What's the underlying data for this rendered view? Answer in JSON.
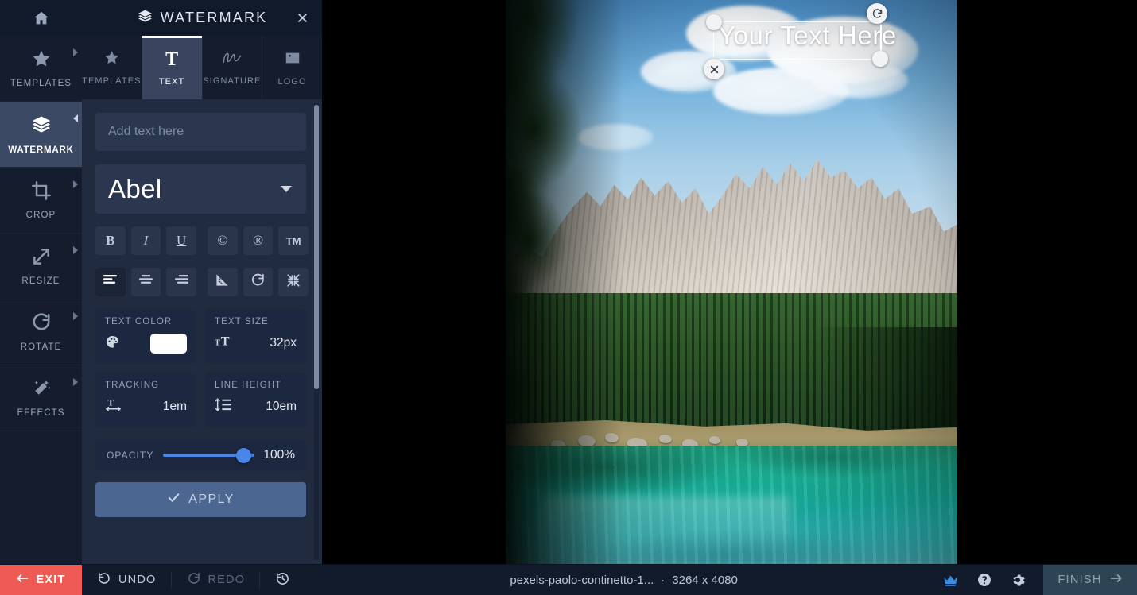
{
  "rail": {
    "home_icon": "home-icon",
    "items": [
      {
        "label": "TEMPLATES",
        "icon": "star-icon",
        "active": false,
        "arrow": "right"
      },
      {
        "label": "WATERMARK",
        "icon": "layers-icon",
        "active": true,
        "arrow": "left"
      },
      {
        "label": "CROP",
        "icon": "crop-icon",
        "active": false,
        "arrow": "right"
      },
      {
        "label": "RESIZE",
        "icon": "resize-icon",
        "active": false,
        "arrow": "right"
      },
      {
        "label": "ROTATE",
        "icon": "rotate-icon",
        "active": false,
        "arrow": "right"
      },
      {
        "label": "EFFECTS",
        "icon": "magicwand-icon",
        "active": false,
        "arrow": "right"
      }
    ]
  },
  "panel": {
    "title": "WATERMARK",
    "title_icon": "layers-icon",
    "close_icon": "close-icon",
    "tabs": [
      {
        "label": "TEMPLATES",
        "icon": "star-icon",
        "active": false
      },
      {
        "label": "TEXT",
        "icon": "text-t-icon",
        "active": true
      },
      {
        "label": "SIGNATURE",
        "icon": "signature-icon",
        "active": false
      },
      {
        "label": "LOGO",
        "icon": "image-icon",
        "active": false
      }
    ],
    "text_input": {
      "value": "",
      "placeholder": "Add text here"
    },
    "font": {
      "selected": "Abel",
      "caret_icon": "chevron-down-icon"
    },
    "style_buttons": [
      {
        "label": "B",
        "name": "bold-button",
        "active": false
      },
      {
        "label": "I",
        "name": "italic-button",
        "active": false
      },
      {
        "label": "U",
        "name": "underline-button",
        "active": false
      },
      {
        "label": "©",
        "name": "copyright-button",
        "active": false
      },
      {
        "label": "®",
        "name": "registered-button",
        "active": false
      },
      {
        "label": "TM",
        "name": "trademark-button",
        "active": false
      }
    ],
    "align_buttons": [
      {
        "name": "align-left-button",
        "icon": "align-left-icon",
        "active": true
      },
      {
        "name": "align-center-button",
        "icon": "align-center-icon",
        "active": false
      },
      {
        "name": "align-right-button",
        "icon": "align-right-icon",
        "active": false
      }
    ],
    "transform_buttons": [
      {
        "name": "skew-button",
        "icon": "triangle-ruler-icon",
        "active": false
      },
      {
        "name": "rotate-button",
        "icon": "rotate-cw-icon",
        "active": false
      },
      {
        "name": "shrink-button",
        "icon": "collapse-arrows-icon",
        "active": false
      }
    ],
    "fields": [
      {
        "label": "TEXT COLOR",
        "value": "",
        "icon": "palette-icon",
        "swatch": "#ffffff"
      },
      {
        "label": "TEXT SIZE",
        "value": "32px",
        "icon": "font-size-icon",
        "swatch": null
      },
      {
        "label": "TRACKING",
        "value": "1em",
        "icon": "tracking-icon",
        "swatch": null
      },
      {
        "label": "LINE HEIGHT",
        "value": "10em",
        "icon": "line-height-icon",
        "swatch": null
      }
    ],
    "opacity": {
      "label": "OPACITY",
      "value": "100%",
      "percent": 100
    },
    "apply": {
      "label": "APPLY",
      "icon": "check-icon"
    }
  },
  "canvas": {
    "watermark": {
      "text": "Your Text Here",
      "close_icon": "close-circle-icon",
      "rotate_icon": "rotate-handle-icon"
    }
  },
  "bottom": {
    "exit": {
      "label": "EXIT",
      "icon": "arrow-left-icon"
    },
    "undo": {
      "label": "UNDO",
      "icon": "undo-icon"
    },
    "redo": {
      "label": "REDO",
      "icon": "redo-icon"
    },
    "history": {
      "label": "",
      "icon": "history-icon"
    },
    "file": {
      "name": "pexels-paolo-continetto-1...",
      "separator": "·",
      "dimensions": "3264 x 4080"
    },
    "right_icons": [
      {
        "name": "crown-icon",
        "label": "premium"
      },
      {
        "name": "help-icon",
        "label": "help"
      },
      {
        "name": "gear-icon",
        "label": "settings"
      }
    ],
    "finish": {
      "label": "FINISH",
      "icon": "arrow-right-icon"
    }
  },
  "colors": {
    "accent_blue": "#4a86e8",
    "exit_red": "#ef5a54",
    "panel_bg": "#202b40",
    "rail_bg": "#141c2e",
    "active_rail": "#3b4965",
    "apply_blue": "#4a6691"
  }
}
